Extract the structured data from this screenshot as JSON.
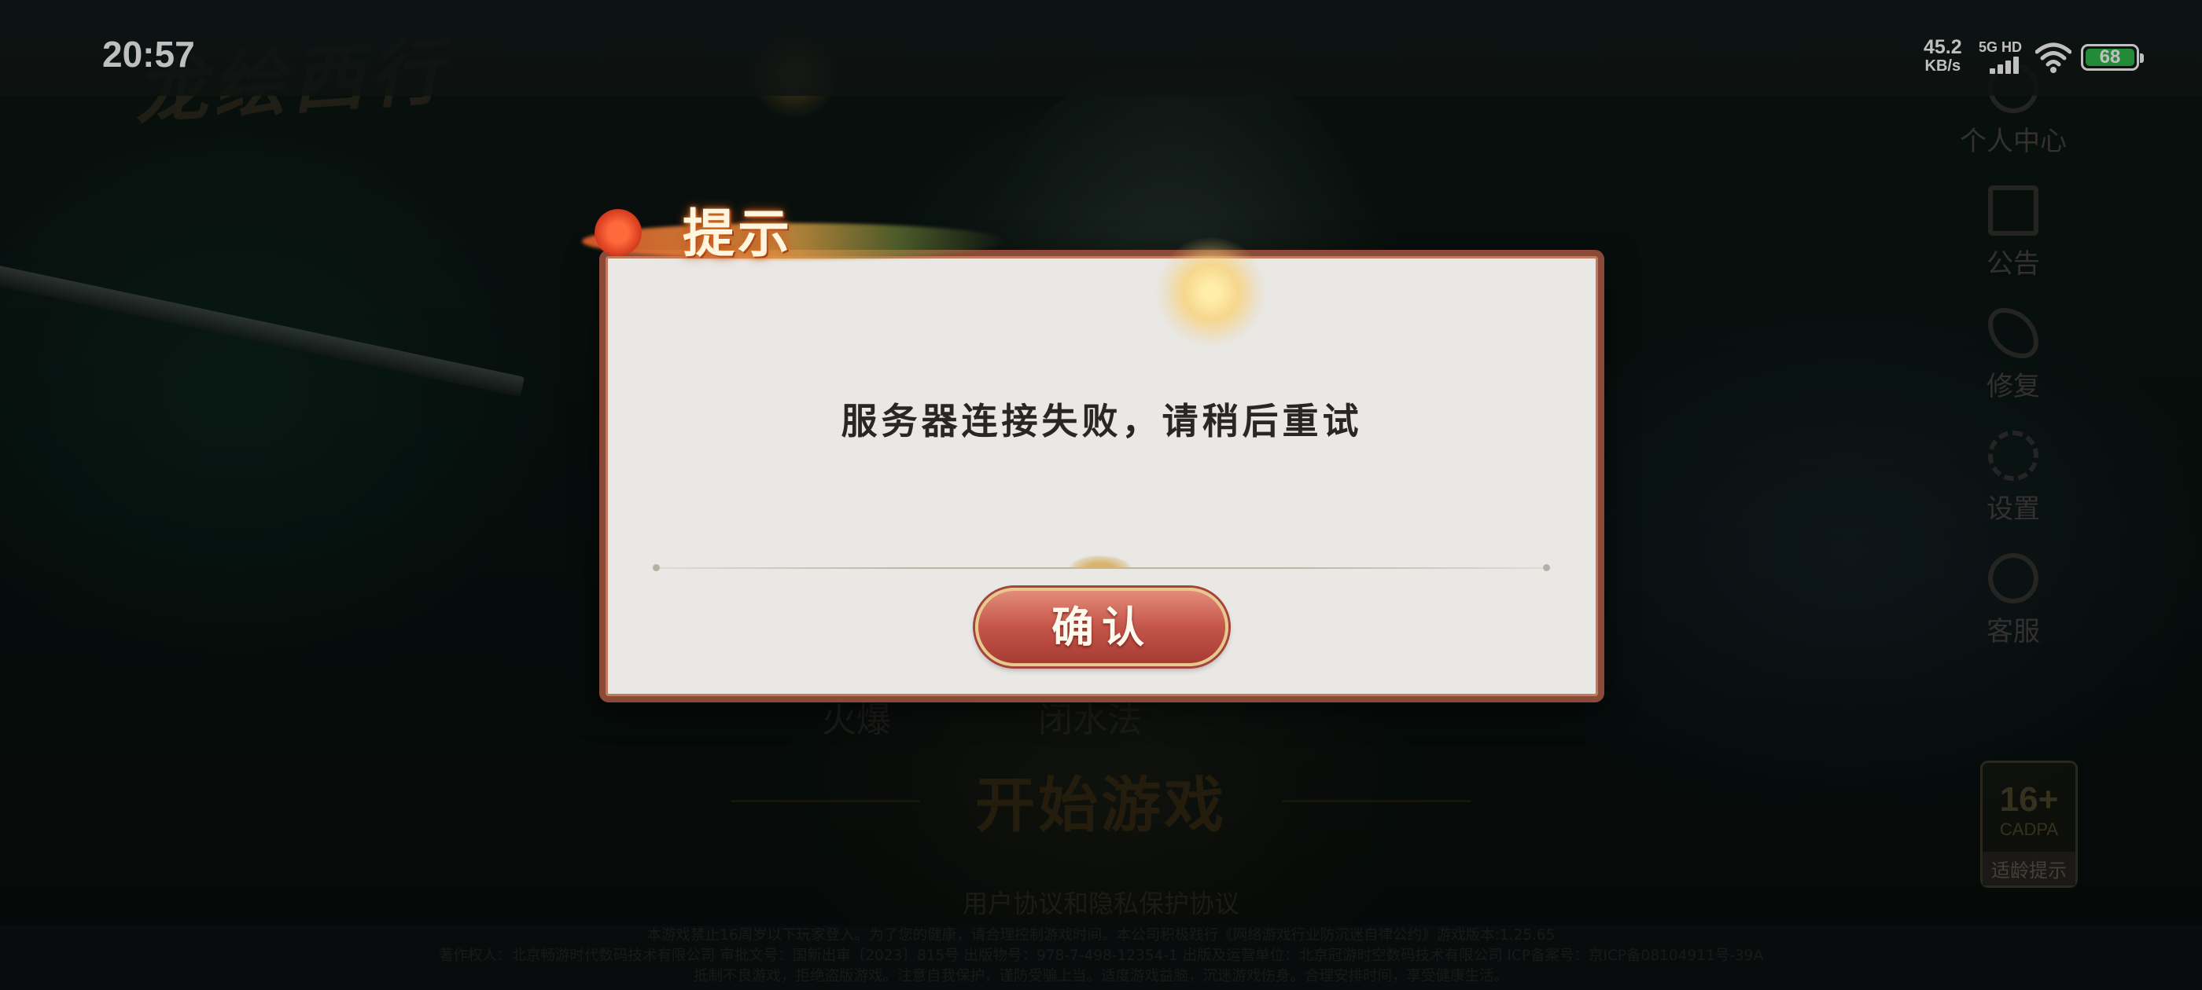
{
  "status_bar": {
    "time": "20:57",
    "net_speed_value": "45.2",
    "net_speed_unit": "KB/s",
    "signal_label": "5G HD",
    "battery_level": "68",
    "battery_color": "#2fb84a"
  },
  "game": {
    "logo_text": "龙绘西行",
    "side_menu": [
      {
        "label": "个人中心",
        "icon": "user-icon"
      },
      {
        "label": "公告",
        "icon": "notice-icon"
      },
      {
        "label": "修复",
        "icon": "wrench-icon"
      },
      {
        "label": "设置",
        "icon": "gear-icon"
      },
      {
        "label": "客服",
        "icon": "support-icon"
      }
    ],
    "server_name": "火爆",
    "server_value": "闭水法",
    "start_button": "开始游戏",
    "agreement_link": "用户协议和隐私保护协议",
    "age_rating": {
      "age": "16+",
      "org": "CADPA",
      "tip": "适龄提示"
    },
    "footer_lines": [
      "本游戏禁止16周岁以下玩家登入。为了您的健康，请合理控制游戏时间。本公司积极践行《网络游戏行业防沉迷自律公约》游戏版本:1.25.65",
      "著作权人：北京畅游时代数码技术有限公司 审批文号：国新出审〔2023〕815号 出版物号：978-7-498-12354-1 出版及运营单位：北京冠游时空数码技术有限公司 ICP备案号：京ICP备08104911号-39A",
      "抵制不良游戏，拒绝盗版游戏。注意自我保护，谨防受骗上当。适度游戏益脑，沉迷游戏伤身。合理安排时间，享受健康生活。"
    ]
  },
  "dialog": {
    "title": "提示",
    "message": "服务器连接失败，请稍后重试",
    "confirm_label": "确认",
    "accent_color": "#8b4a37",
    "button_color": "#c4554a"
  }
}
